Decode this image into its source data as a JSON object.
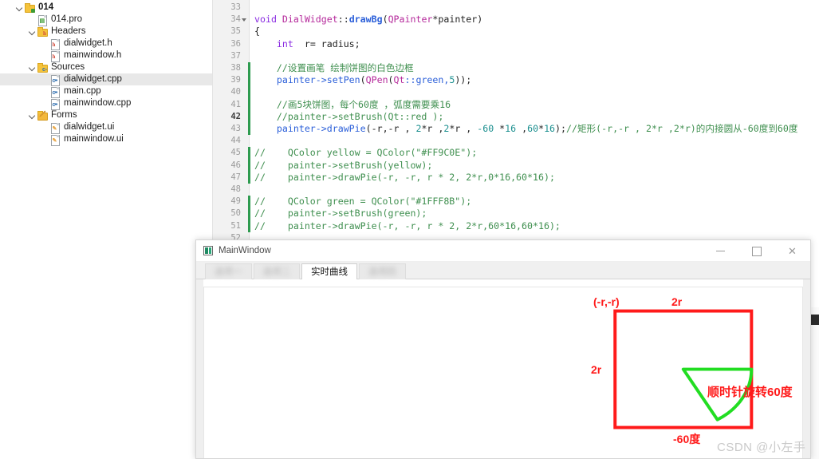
{
  "project_tree": {
    "items": [
      {
        "label": "014",
        "indent": 0,
        "icon": "folder-project-icon",
        "expander": "expanded",
        "bold": true,
        "selected": false
      },
      {
        "label": "014.pro",
        "indent": 1,
        "icon": "pro-file-icon",
        "expander": "none",
        "bold": false,
        "selected": false
      },
      {
        "label": "Headers",
        "indent": 1,
        "icon": "folder-headers-icon",
        "expander": "expanded",
        "bold": false,
        "selected": false
      },
      {
        "label": "dialwidget.h",
        "indent": 2,
        "icon": "header-file-icon",
        "expander": "none",
        "bold": false,
        "selected": false
      },
      {
        "label": "mainwindow.h",
        "indent": 2,
        "icon": "header-file-icon",
        "expander": "none",
        "bold": false,
        "selected": false
      },
      {
        "label": "Sources",
        "indent": 1,
        "icon": "folder-sources-icon",
        "expander": "expanded",
        "bold": false,
        "selected": false
      },
      {
        "label": "dialwidget.cpp",
        "indent": 2,
        "icon": "cpp-file-icon",
        "expander": "none",
        "bold": false,
        "selected": true
      },
      {
        "label": "main.cpp",
        "indent": 2,
        "icon": "cpp-file-icon",
        "expander": "none",
        "bold": false,
        "selected": false
      },
      {
        "label": "mainwindow.cpp",
        "indent": 2,
        "icon": "cpp-file-icon",
        "expander": "none",
        "bold": false,
        "selected": false
      },
      {
        "label": "Forms",
        "indent": 1,
        "icon": "folder-forms-icon",
        "expander": "expanded",
        "bold": false,
        "selected": false
      },
      {
        "label": "dialwidget.ui",
        "indent": 2,
        "icon": "ui-file-icon",
        "expander": "none",
        "bold": false,
        "selected": false
      },
      {
        "label": "mainwindow.ui",
        "indent": 2,
        "icon": "ui-file-icon",
        "expander": "none",
        "bold": false,
        "selected": false
      }
    ]
  },
  "editor": {
    "current_line": 42,
    "lines": [
      {
        "n": 33,
        "fold": false,
        "changed": false,
        "tokens": []
      },
      {
        "n": 34,
        "fold": true,
        "changed": false,
        "tokens": [
          {
            "t": "void ",
            "c": "kw"
          },
          {
            "t": "DialWidget",
            "c": "cls"
          },
          {
            "t": "::",
            "c": "pl"
          },
          {
            "t": "drawBg",
            "c": "fn"
          },
          {
            "t": "(",
            "c": "pl"
          },
          {
            "t": "QPainter",
            "c": "cls"
          },
          {
            "t": "*painter)",
            "c": "pl"
          }
        ]
      },
      {
        "n": 35,
        "fold": false,
        "changed": false,
        "tokens": [
          {
            "t": "{",
            "c": "pl"
          }
        ]
      },
      {
        "n": 36,
        "fold": false,
        "changed": false,
        "tokens": [
          {
            "t": "    ",
            "c": "pl"
          },
          {
            "t": "int",
            "c": "kw"
          },
          {
            "t": "  r= radius;",
            "c": "pl"
          }
        ]
      },
      {
        "n": 37,
        "fold": false,
        "changed": false,
        "tokens": []
      },
      {
        "n": 38,
        "fold": false,
        "changed": true,
        "tokens": [
          {
            "t": "    //设置画笔 绘制饼图的白色边框",
            "c": "cmt"
          }
        ]
      },
      {
        "n": 39,
        "fold": false,
        "changed": true,
        "tokens": [
          {
            "t": "    painter->",
            "c": "id"
          },
          {
            "t": "setPen",
            "c": "id"
          },
          {
            "t": "(",
            "c": "pl"
          },
          {
            "t": "QPen",
            "c": "cls"
          },
          {
            "t": "(",
            "c": "pl"
          },
          {
            "t": "Qt",
            "c": "cls"
          },
          {
            "t": "::green,",
            "c": "id"
          },
          {
            "t": "5",
            "c": "num"
          },
          {
            "t": "));",
            "c": "pl"
          }
        ]
      },
      {
        "n": 40,
        "fold": false,
        "changed": true,
        "tokens": []
      },
      {
        "n": 41,
        "fold": false,
        "changed": true,
        "tokens": [
          {
            "t": "    //画5块饼图，每个60度 ，弧度需要乘16",
            "c": "cmt"
          }
        ]
      },
      {
        "n": 42,
        "fold": false,
        "changed": true,
        "tokens": [
          {
            "t": "    //painter->setBrush(Qt::red );",
            "c": "cmt"
          }
        ]
      },
      {
        "n": 43,
        "fold": false,
        "changed": true,
        "tokens": [
          {
            "t": "    painter->",
            "c": "id"
          },
          {
            "t": "drawPie",
            "c": "id"
          },
          {
            "t": "(-r,-r , ",
            "c": "pl"
          },
          {
            "t": "2",
            "c": "num"
          },
          {
            "t": "*r ,",
            "c": "pl"
          },
          {
            "t": "2",
            "c": "num"
          },
          {
            "t": "*r , ",
            "c": "pl"
          },
          {
            "t": "-60",
            "c": "num"
          },
          {
            "t": " *",
            "c": "pl"
          },
          {
            "t": "16",
            "c": "num"
          },
          {
            "t": " ,",
            "c": "pl"
          },
          {
            "t": "60",
            "c": "num"
          },
          {
            "t": "*",
            "c": "pl"
          },
          {
            "t": "16",
            "c": "num"
          },
          {
            "t": ");",
            "c": "pl"
          },
          {
            "t": "//矩形(-r,-r , 2*r ,2*r)的内接圆从-60度到60度",
            "c": "cmt"
          }
        ]
      },
      {
        "n": 44,
        "fold": false,
        "changed": false,
        "tokens": []
      },
      {
        "n": 45,
        "fold": false,
        "changed": true,
        "tokens": [
          {
            "t": "//    QColor yellow = QColor(\"#FF9C0E\");",
            "c": "cmt"
          }
        ]
      },
      {
        "n": 46,
        "fold": false,
        "changed": true,
        "tokens": [
          {
            "t": "//    painter->setBrush(yellow);",
            "c": "cmt"
          }
        ]
      },
      {
        "n": 47,
        "fold": false,
        "changed": true,
        "tokens": [
          {
            "t": "//    painter->drawPie(-r, -r, r * 2, 2*r,0*16,60*16);",
            "c": "cmt"
          }
        ]
      },
      {
        "n": 48,
        "fold": false,
        "changed": false,
        "tokens": []
      },
      {
        "n": 49,
        "fold": false,
        "changed": true,
        "tokens": [
          {
            "t": "//    QColor green = QColor(\"#1FFF8B\");",
            "c": "cmt"
          }
        ]
      },
      {
        "n": 50,
        "fold": false,
        "changed": true,
        "tokens": [
          {
            "t": "//    painter->setBrush(green);",
            "c": "cmt"
          }
        ]
      },
      {
        "n": 51,
        "fold": false,
        "changed": true,
        "tokens": [
          {
            "t": "//    painter->drawPie(-r, -r, r * 2, 2*r,60*16,60*16);",
            "c": "cmt"
          }
        ]
      },
      {
        "n": 52,
        "fold": false,
        "changed": false,
        "tokens": []
      }
    ]
  },
  "mainwindow": {
    "title": "MainWindow",
    "window_buttons": {
      "minimize": "–",
      "maximize": "□",
      "close": "✕"
    },
    "tabs": [
      {
        "label": "选项一",
        "active": false,
        "blurred": true
      },
      {
        "label": "选项二",
        "active": false,
        "blurred": true
      },
      {
        "label": "实时曲线",
        "active": true,
        "blurred": false
      },
      {
        "label": "选项四",
        "active": false,
        "blurred": true
      }
    ]
  },
  "diagram": {
    "colors": {
      "rect": "#ff1a1a",
      "pie": "#22dd22"
    },
    "annotations": {
      "corner": "(-r,-r)",
      "width": "2r",
      "height": "2r",
      "rotation": "顺时针旋转60度",
      "angle": "-60度"
    }
  },
  "watermark": "CSDN @小左手"
}
